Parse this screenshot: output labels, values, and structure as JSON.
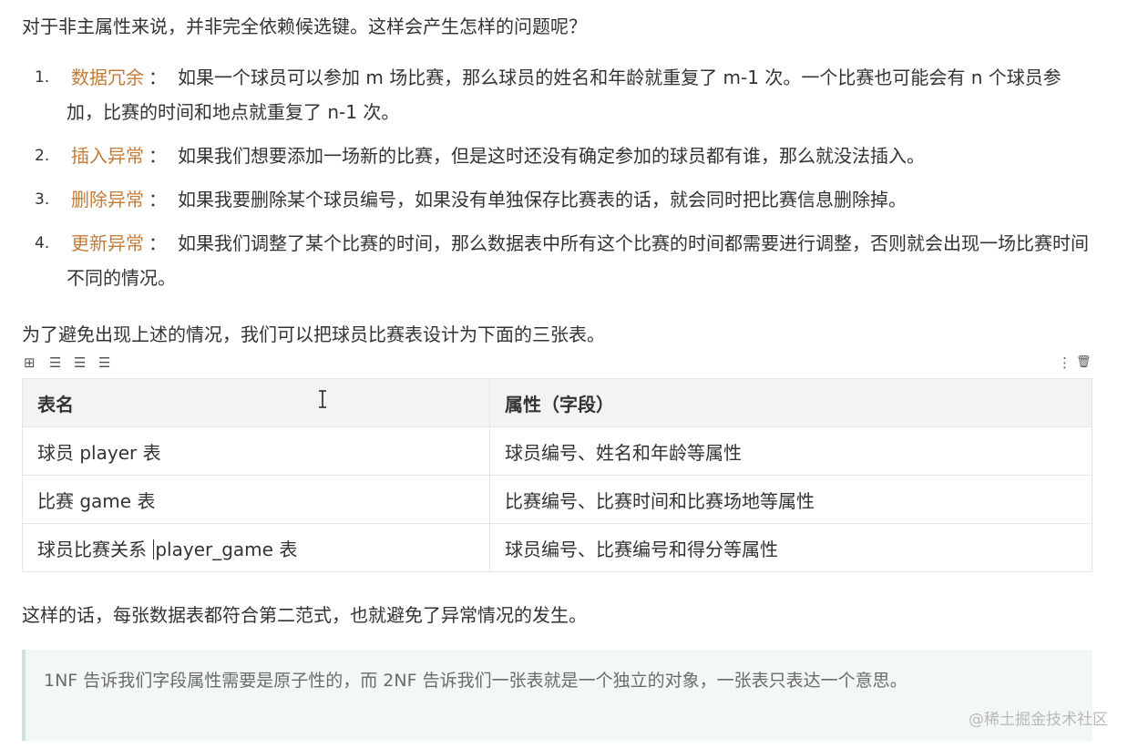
{
  "intro": "对于非主属性来说，并非完全依赖候选键。这样会产生怎样的问题呢？",
  "issues": [
    {
      "num": "1.",
      "term": "数据冗余",
      "sep": "：",
      "text": "如果一个球员可以参加 m 场比赛，那么球员的姓名和年龄就重复了 m-1 次。一个比赛也可能会有 n 个球员参加，比赛的时间和地点就重复了 n-1 次。"
    },
    {
      "num": "2.",
      "term": "插入异常",
      "sep": "：",
      "text": "如果我们想要添加一场新的比赛，但是这时还没有确定参加的球员都有谁，那么就没法插入。"
    },
    {
      "num": "3.",
      "term": "删除异常",
      "sep": "：",
      "text": "如果我要删除某个球员编号，如果没有单独保存比赛表的话，就会同时把比赛信息删除掉。"
    },
    {
      "num": "4.",
      "term": "更新异常",
      "sep": "：",
      "text": "如果我们调整了某个比赛的时间，那么数据表中所有这个比赛的时间都需要进行调整，否则就会出现一场比赛时间不同的情况。"
    }
  ],
  "lead": "为了避免出现上述的情况，我们可以把球员比赛表设计为下面的三张表。",
  "toolbar": {
    "grid_icon": "grid-icon",
    "align_left_icon": "align-left-icon",
    "align_center_icon": "align-center-icon",
    "align_right_icon": "align-right-icon",
    "more_icon": "more-vertical-icon",
    "delete_icon": "trash-icon",
    "glyphs": {
      "grid": "⊞",
      "left": "☰",
      "center": "☰",
      "right": "☰",
      "more": "⋮",
      "delete": "🗑"
    }
  },
  "table": {
    "headers": [
      "表名",
      "属性（字段）"
    ],
    "rows": [
      [
        "球员 player 表",
        "球员编号、姓名和年龄等属性"
      ],
      [
        "比赛 game 表",
        "比赛编号、比赛时间和比赛场地等属性"
      ],
      [
        "球员比赛关系 player_game 表",
        "球员编号、比赛编号和得分等属性"
      ]
    ],
    "row3_col1_before_caret": "球员比赛关系 ",
    "row3_col1_after_caret": "player_game 表"
  },
  "outro": "这样的话，每张数据表都符合第二范式，也就避免了异常情况的发生。",
  "quote": "1NF 告诉我们字段属性需要是原子性的，而 2NF 告诉我们一张表就是一个独立的对象，一张表只表达一个意思。",
  "watermark": "@稀土掘金技术社区",
  "colors": {
    "term": "#c27c3a",
    "quote_bg": "#f2f8f4",
    "quote_border": "#cfe3d6",
    "table_header_bg": "#f3f3f3"
  }
}
